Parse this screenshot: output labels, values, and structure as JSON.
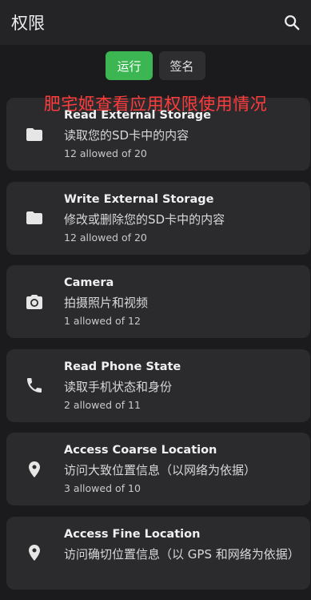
{
  "appbar": {
    "title": "权限",
    "search_icon": "search-icon"
  },
  "tabs": [
    {
      "label": "运行",
      "active": true
    },
    {
      "label": "签名",
      "active": false
    }
  ],
  "watermark": "肥宅姬查看应用权限使用情况",
  "colors": {
    "accent": "#3cb553",
    "watermark": "#ff3b3b",
    "card": "#2b2b2e",
    "background": "#1b1b1d"
  },
  "permissions": [
    {
      "title": "Read External Storage",
      "desc": "读取您的SD卡中的内容",
      "count": "12 allowed of 20",
      "icon": "folder-icon"
    },
    {
      "title": "Write External Storage",
      "desc": "修改或删除您的SD卡中的内容",
      "count": "12 allowed of 20",
      "icon": "folder-icon"
    },
    {
      "title": "Camera",
      "desc": "拍摄照片和视频",
      "count": "1 allowed of 12",
      "icon": "camera-icon"
    },
    {
      "title": "Read Phone State",
      "desc": "读取手机状态和身份",
      "count": "2 allowed of 11",
      "icon": "phone-icon"
    },
    {
      "title": "Access Coarse Location",
      "desc": "访问大致位置信息（以网络为依据）",
      "count": "3 allowed of 10",
      "icon": "location-pin-icon"
    },
    {
      "title": "Access Fine Location",
      "desc": "访问确切位置信息（以 GPS 和网络为依据）",
      "count": "",
      "icon": "location-pin-icon"
    }
  ]
}
